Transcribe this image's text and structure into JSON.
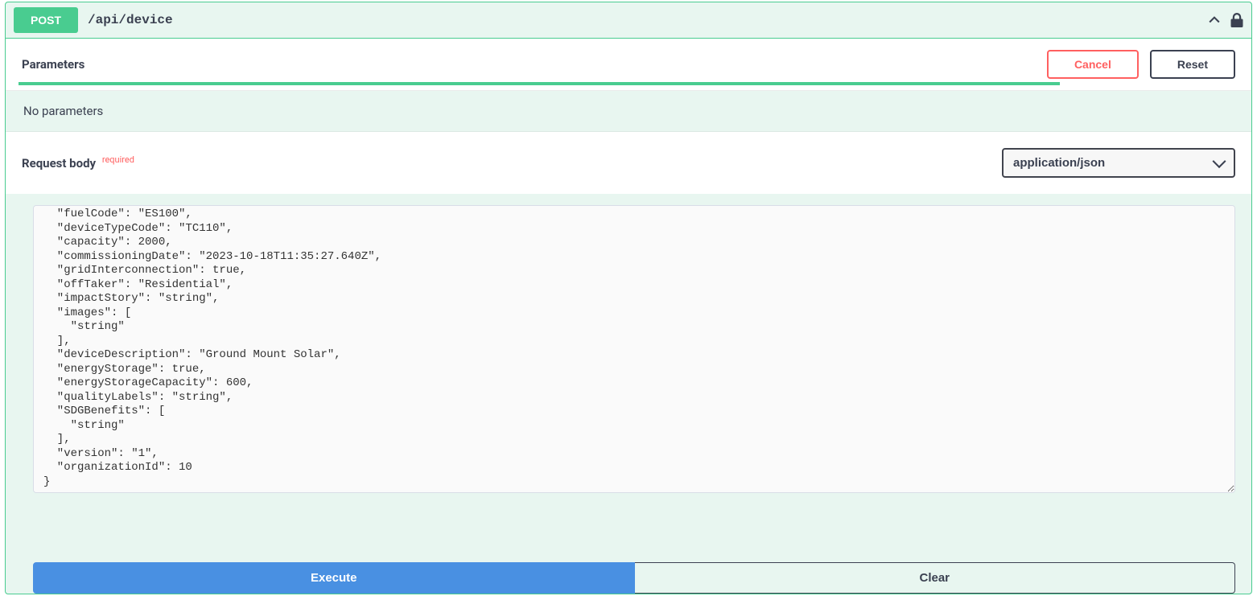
{
  "summary": {
    "method": "POST",
    "path": "/api/device"
  },
  "parameters": {
    "title": "Parameters",
    "empty_text": "No parameters",
    "cancel_label": "Cancel",
    "reset_label": "Reset"
  },
  "request_body": {
    "title": "Request body",
    "required_label": "required",
    "content_type": "application/json",
    "body_text": "  \"fuelCode\": \"ES100\",\n  \"deviceTypeCode\": \"TC110\",\n  \"capacity\": 2000,\n  \"commissioningDate\": \"2023-10-18T11:35:27.640Z\",\n  \"gridInterconnection\": true,\n  \"offTaker\": \"Residential\",\n  \"impactStory\": \"string\",\n  \"images\": [\n    \"string\"\n  ],\n  \"deviceDescription\": \"Ground Mount Solar\",\n  \"energyStorage\": true,\n  \"energyStorageCapacity\": 600,\n  \"qualityLabels\": \"string\",\n  \"SDGBenefits\": [\n    \"string\"\n  ],\n  \"version\": \"1\",\n  \"organizationId\": 10\n}"
  },
  "actions": {
    "execute_label": "Execute",
    "clear_label": "Clear"
  }
}
